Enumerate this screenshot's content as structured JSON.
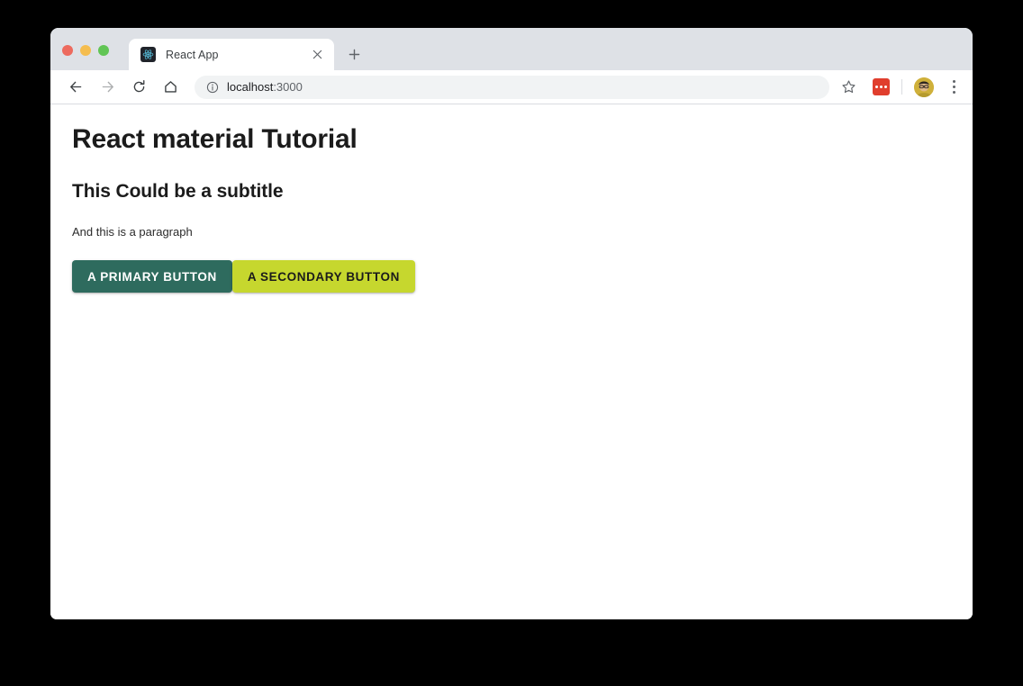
{
  "window": {
    "traffic_lights": [
      {
        "name": "close",
        "color": "#ed6a5e"
      },
      {
        "name": "minimize",
        "color": "#f5bd4f"
      },
      {
        "name": "maximize",
        "color": "#61c555"
      }
    ]
  },
  "browser": {
    "tab": {
      "title": "React App",
      "favicon_name": "react-logo-favicon",
      "close_label": "×"
    },
    "new_tab_label": "+",
    "toolbar": {
      "back_icon": "arrow-left-icon",
      "forward_icon": "arrow-right-icon",
      "reload_icon": "reload-icon",
      "home_icon": "home-icon",
      "security_icon": "info-circle-icon",
      "url_prefix": "localhost",
      "url_suffix": ":3000",
      "url_full": "localhost:3000",
      "bookmark_icon": "star-icon",
      "extension_icon": "extension-red-icon",
      "profile_icon": "user-avatar",
      "menu_icon": "three-dot-menu-icon"
    }
  },
  "page": {
    "heading": "React material Tutorial",
    "subheading": "This Could be a subtitle",
    "paragraph": "And this is a paragraph",
    "buttons": [
      {
        "label": "A PRIMARY BUTTON",
        "background": "#2e6b5e",
        "text_color": "#ffffff"
      },
      {
        "label": "A SECONDARY BUTTON",
        "background": "#c6d72e",
        "text_color": "#1b1b1b"
      }
    ]
  }
}
